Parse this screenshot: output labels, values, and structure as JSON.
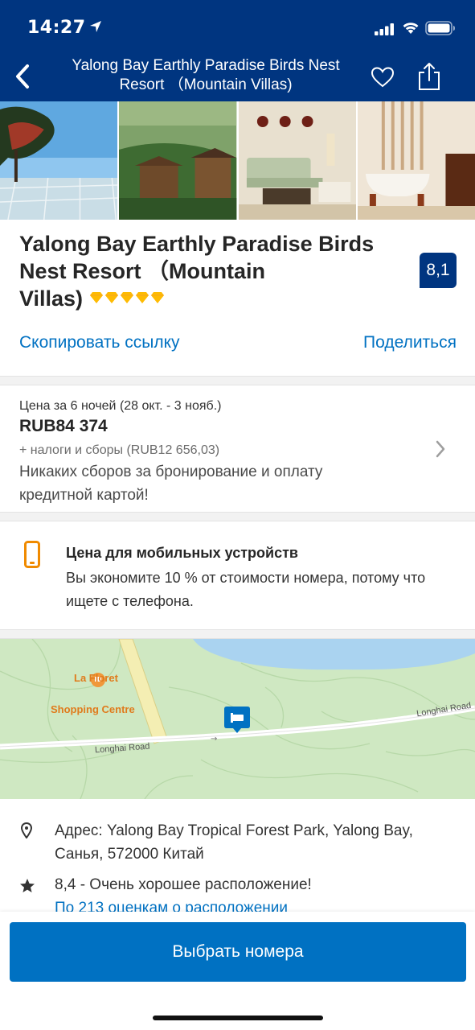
{
  "status_bar": {
    "time": "14:27"
  },
  "nav": {
    "title": "Yalong Bay Earthly Paradise Birds Nest Resort （Mountain Villas)",
    "icons": [
      "back-chevron-icon",
      "heart-icon",
      "share-icon"
    ]
  },
  "gallery": {
    "photos": [
      "photo-cliff-viewpoint",
      "photo-hillside-villas",
      "photo-living-room",
      "photo-bathroom"
    ]
  },
  "hotel": {
    "name_line1": "Yalong Bay Earthly Paradise Birds",
    "name_line2": "Nest Resort （Mountain",
    "name_line3": "Villas)",
    "stars": 5,
    "score": "8,1"
  },
  "links": {
    "copy_link": "Скопировать ссылку",
    "share": "Поделиться"
  },
  "price": {
    "label": "Цена за 6 ночей (28 окт. - 3 нояб.)",
    "value": "RUB84 374",
    "taxes": "+ налоги и сборы (RUB12 656,03)",
    "note": "Никаких сборов за бронирование и оплату кредитной картой!"
  },
  "mobile_deal": {
    "title": "Цена для мобильных устройств",
    "text": "Вы экономите 10 % от стоимости номера, потому что ищете с телефона."
  },
  "map": {
    "poi_name_line1": "La Floret",
    "poi_name_line2": "Shopping Centre",
    "road_left": "Longhai Road",
    "road_right": "Longhai Road"
  },
  "address": {
    "text": "Адрес: Yalong Bay Tropical Forest Park, Yalong Bay, Санья, 572000 Китай",
    "location_score": "8,4 - Очень хорошее расположение!",
    "location_link": "По 213 оценкам о расположении"
  },
  "cta": {
    "label": "Выбрать номера"
  },
  "colors": {
    "brand_dark": "#003580",
    "link_blue": "#0071c2",
    "star_yellow": "#febb02",
    "mobile_orange": "#f08a00"
  }
}
